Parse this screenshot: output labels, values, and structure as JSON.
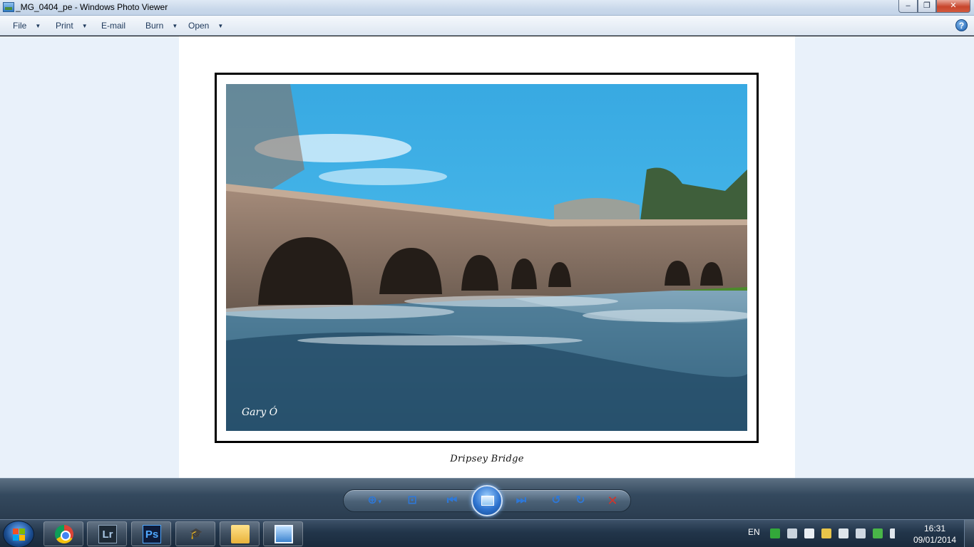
{
  "window": {
    "title": "_MG_0404_pe - Windows Photo Viewer",
    "min_label": "–",
    "max_label": "❐",
    "close_label": "✕"
  },
  "menu": {
    "file": "File",
    "print": "Print",
    "email": "E-mail",
    "burn": "Burn",
    "open": "Open",
    "help": "?"
  },
  "photo": {
    "caption": "Dripsey Bridge",
    "signature": "Gary Ó"
  },
  "controls": {
    "zoom": "zoom-icon",
    "actual_size": "actual-size-icon",
    "previous": "previous-icon",
    "slideshow": "slideshow-icon",
    "next": "next-icon",
    "rotate_ccw": "rotate-counterclockwise-icon",
    "rotate_cw": "rotate-clockwise-icon",
    "delete": "delete-icon"
  },
  "taskbar": {
    "lightroom_label": "Lr",
    "photoshop_label": "Ps",
    "language": "EN",
    "time": "16:31",
    "date": "09/01/2014"
  },
  "colors": {
    "sky": "#3fb2e8",
    "water": "#2b5f7c",
    "accent": "#2e78d8"
  }
}
